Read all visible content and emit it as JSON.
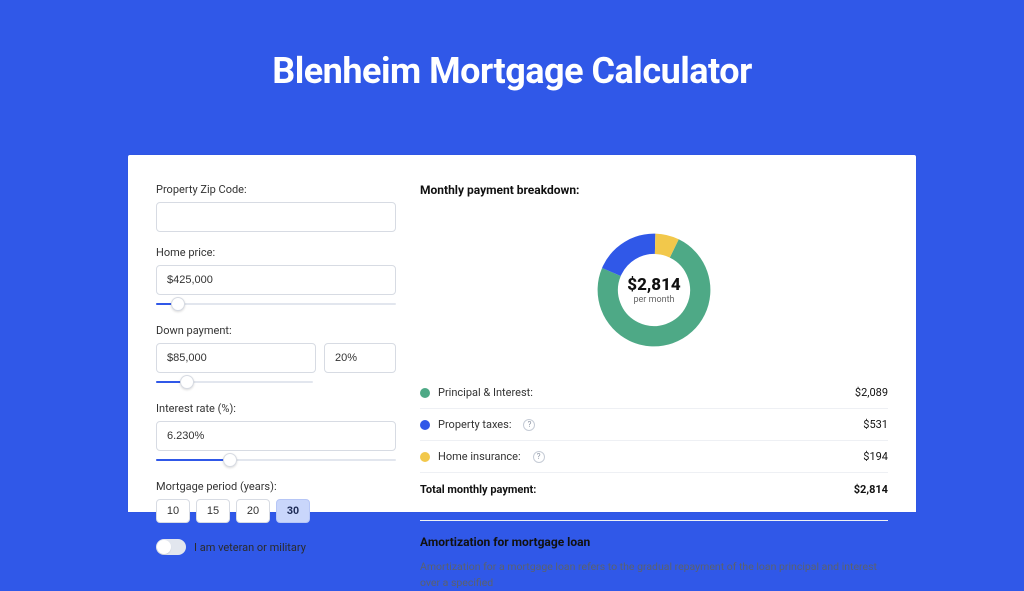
{
  "title": "Blenheim Mortgage Calculator",
  "colors": {
    "primary": "#3058e8",
    "pi": "#4ea986",
    "tax": "#3058e8",
    "ins": "#f2c84b"
  },
  "form": {
    "zip": {
      "label": "Property Zip Code:",
      "value": ""
    },
    "home_price": {
      "label": "Home price:",
      "value": "$425,000",
      "slider_pct": 9
    },
    "down_payment": {
      "label": "Down payment:",
      "amount": "$85,000",
      "pct": "20%",
      "slider_pct": 20
    },
    "interest": {
      "label": "Interest rate (%):",
      "value": "6.230%",
      "slider_pct": 31
    },
    "period": {
      "label": "Mortgage period (years):",
      "options": [
        "10",
        "15",
        "20",
        "30"
      ],
      "active": "30"
    },
    "veteran": {
      "label": "I am veteran or military",
      "on": false
    }
  },
  "breakdown": {
    "title": "Monthly payment breakdown:",
    "donut": {
      "amount": "$2,814",
      "sub": "per month",
      "segments": {
        "ins_pct": 7,
        "tax_pct": 19,
        "pi_pct": 74
      }
    },
    "rows": [
      {
        "color": "#4ea986",
        "label": "Principal & Interest:",
        "help": false,
        "value": "$2,089"
      },
      {
        "color": "#3058e8",
        "label": "Property taxes:",
        "help": true,
        "value": "$531"
      },
      {
        "color": "#f2c84b",
        "label": "Home insurance:",
        "help": true,
        "value": "$194"
      }
    ],
    "total": {
      "label": "Total monthly payment:",
      "value": "$2,814"
    }
  },
  "amort": {
    "title": "Amortization for mortgage loan",
    "body": "Amortization for a mortgage loan refers to the gradual repayment of the loan principal and interest over a specified"
  },
  "chart_data": {
    "type": "pie",
    "title": "Monthly payment breakdown",
    "categories": [
      "Principal & Interest",
      "Property taxes",
      "Home insurance"
    ],
    "values": [
      2089,
      531,
      194
    ],
    "colors": [
      "#4ea986",
      "#3058e8",
      "#f2c84b"
    ],
    "center_label": "$2,814 per month",
    "total": 2814
  }
}
